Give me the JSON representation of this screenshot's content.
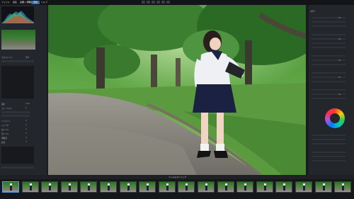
{
  "menu": [
    "ファイル",
    "編集",
    "画像",
    "調整",
    "表示",
    "ヘルプ"
  ],
  "modes": {
    "library": "ライブラリ",
    "edit": "現像",
    "view": "表示"
  },
  "left_panel": {
    "rows": [
      {
        "label": "プロファイル",
        "value": "標準"
      },
      {
        "label": "露出",
        "value": "0.00"
      },
      {
        "label": "コントラスト",
        "value": "0"
      },
      {
        "label": "ハイライト",
        "value": "0"
      },
      {
        "label": "シャドウ",
        "value": "0"
      },
      {
        "label": "白レベル",
        "value": "0"
      },
      {
        "label": "黒レベル",
        "value": "0"
      },
      {
        "label": "明瞭度",
        "value": "0"
      },
      {
        "label": "彩度",
        "value": "0"
      }
    ]
  },
  "right_panel": {
    "heading": "カラー",
    "wheel_icon": "color-wheel-icon"
  },
  "filmstrip": {
    "label": "フィルムストリップ",
    "captions": [
      "",
      "",
      "",
      "",
      "",
      "",
      "",
      "",
      "",
      "",
      "",
      "",
      "",
      "",
      "",
      "",
      "",
      ""
    ]
  },
  "colors": {
    "accent": "#2f6db5",
    "panel": "#23262b",
    "bg": "#1a1c20"
  }
}
